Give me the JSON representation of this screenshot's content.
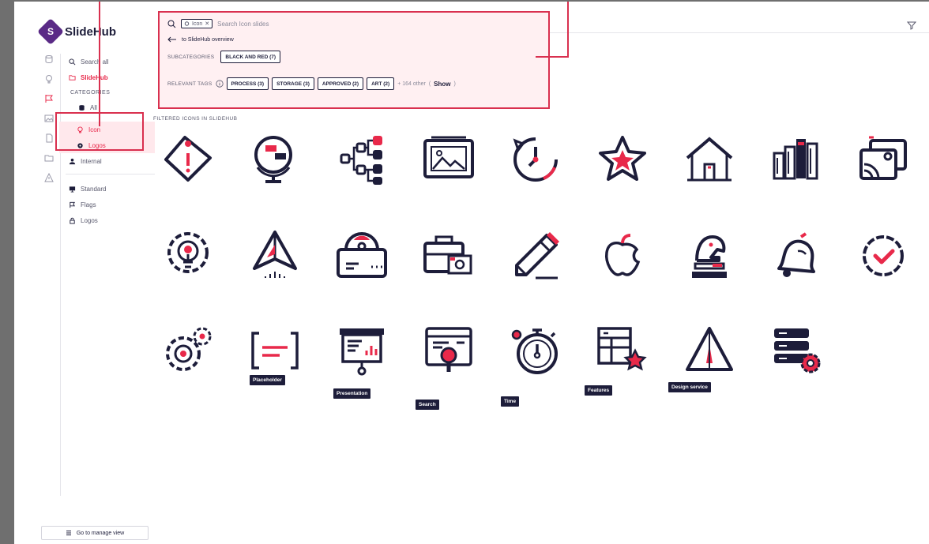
{
  "app": {
    "name": "SlideHub",
    "logo_letter": "S"
  },
  "sidebar": {
    "search_label": "Search all",
    "brand_link": "SlideHub",
    "categories_label": "CATEGORIES",
    "items": [
      {
        "label": "All"
      },
      {
        "label": "Icon"
      },
      {
        "label": "Logos"
      },
      {
        "label": "Internal"
      }
    ],
    "secondary": [
      {
        "label": "Standard"
      },
      {
        "label": "Flags"
      },
      {
        "label": "Logos"
      }
    ],
    "manage_button": "Go to manage view"
  },
  "filter_panel": {
    "active_chip": "Icon",
    "search_placeholder": "Search Icon slides",
    "back_link": "to SlideHub overview",
    "subcategories_label": "SUBCATEGORIES",
    "subcategories": [
      "BLACK AND RED (7)"
    ],
    "relevant_tags_label": "RELEVANT TAGS",
    "tags": [
      "PROCESS (3)",
      "STORAGE (3)",
      "APPROVED (2)",
      "ART (2)"
    ],
    "more_text": "+ 164 other",
    "show_label": "Show"
  },
  "grid": {
    "title": "FILTERED ICONS IN SLIDEHUB",
    "icons": [
      "tag-alert",
      "globe-chat",
      "flowchart",
      "picture-frame",
      "clock",
      "star",
      "house",
      "books",
      "photos",
      "lightbulb-gear",
      "paper-plane",
      "box",
      "briefcase-money",
      "pencil",
      "apple",
      "chess-knight",
      "bell",
      "check-badge",
      "gears",
      "placeholder",
      "presentation",
      "search-browser",
      "stopwatch",
      "features-table",
      "design-triangle",
      "server-gear"
    ],
    "labels": {
      "placeholder": "Placeholder",
      "presentation": "Presentation",
      "search": "Search",
      "time": "Time",
      "features": "Features",
      "design": "Design service"
    }
  },
  "colors": {
    "accent": "#e8294a",
    "ink": "#1d1d3a",
    "panel_bg": "#fff0f2",
    "annotation": "#d9304f"
  }
}
